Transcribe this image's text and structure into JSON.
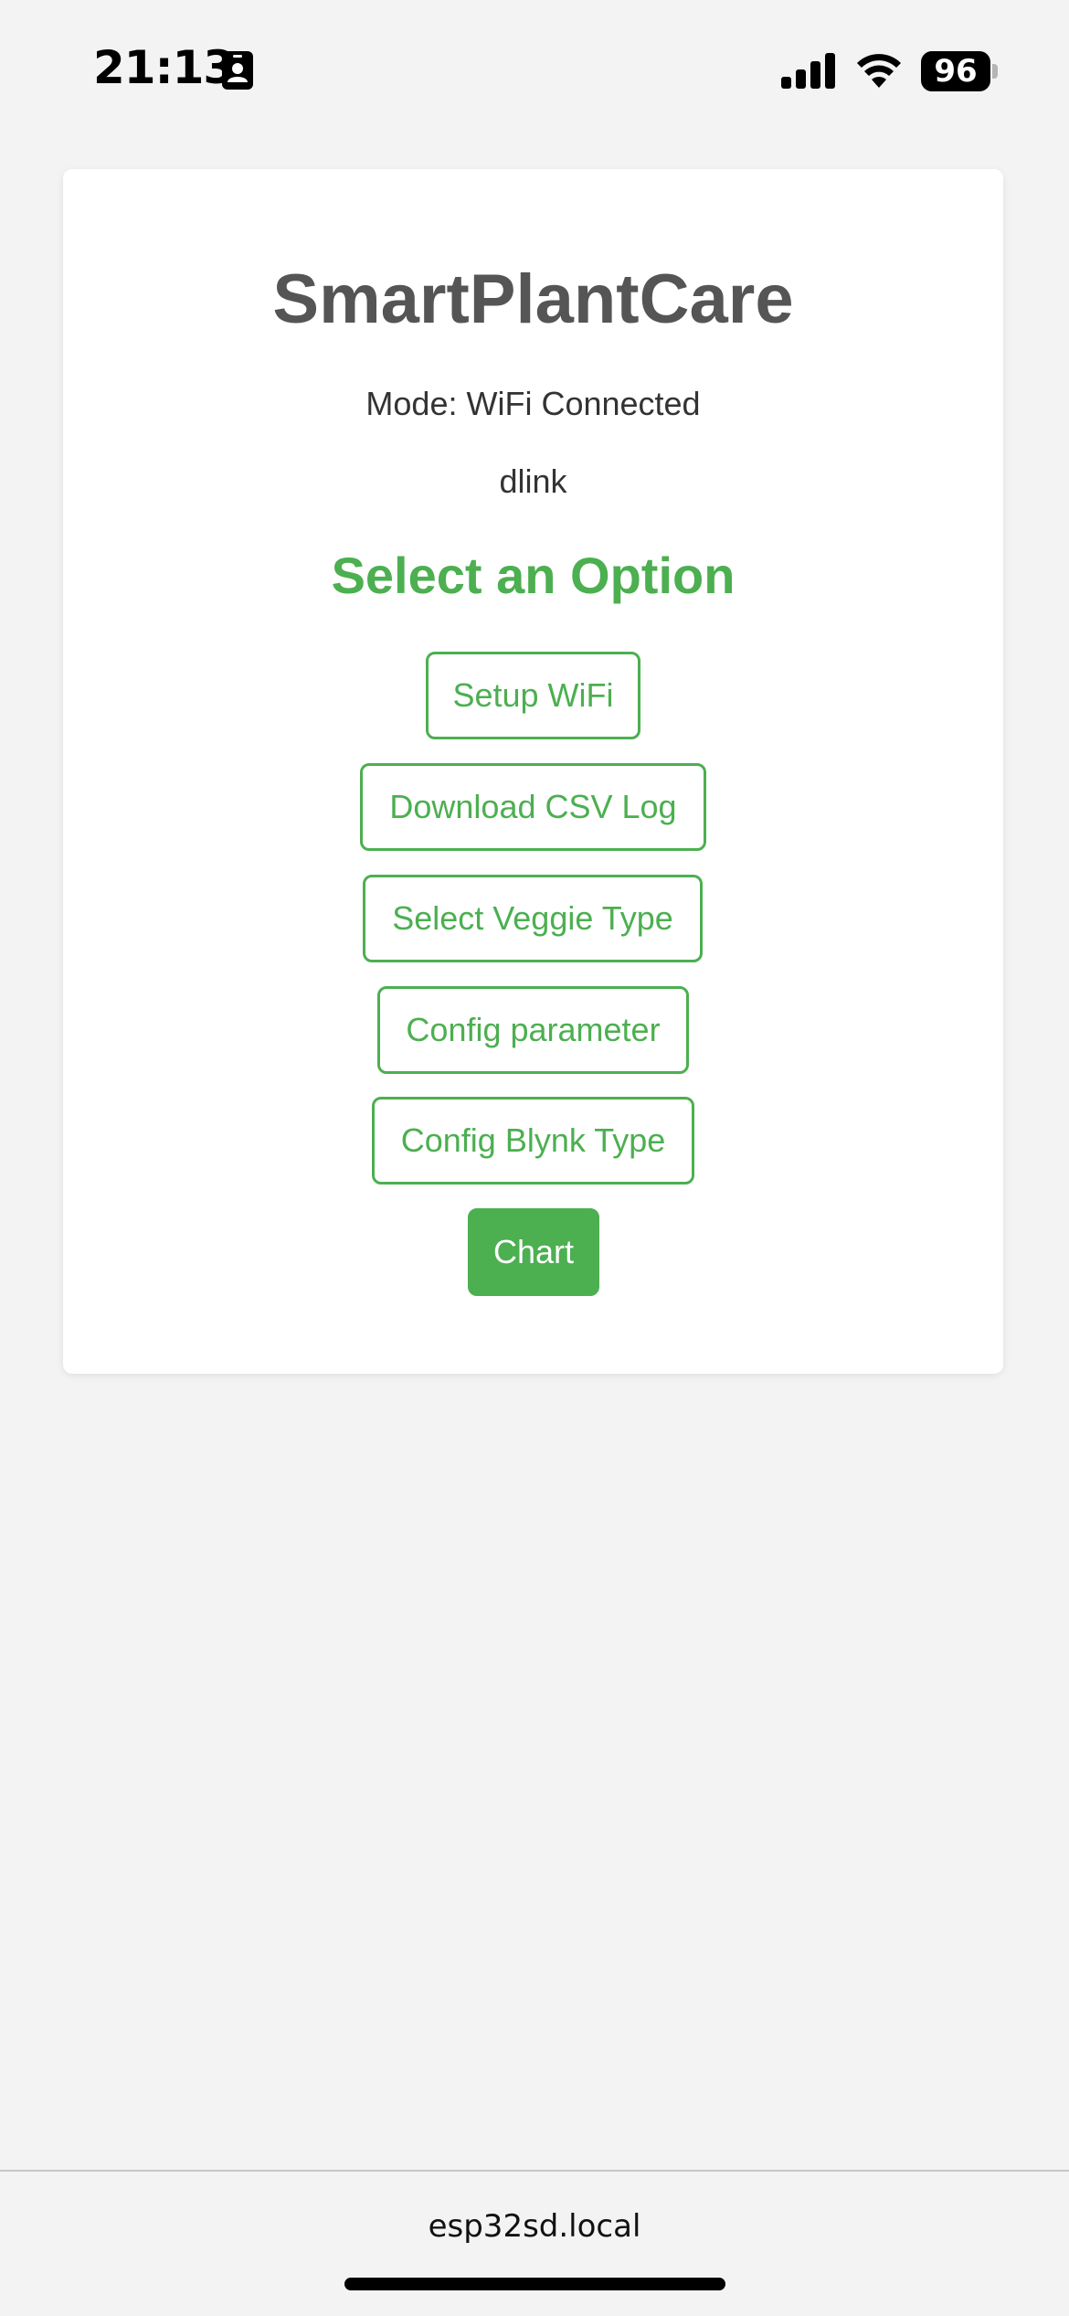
{
  "status_bar": {
    "time": "21:13",
    "battery_level": "96",
    "icons": [
      "contact-card-icon",
      "signal-icon",
      "wifi-icon",
      "battery-icon"
    ]
  },
  "card": {
    "title": "SmartPlantCare",
    "mode": "Mode: WiFi Connected",
    "ssid": "dlink",
    "heading": "Select an Option",
    "buttons": {
      "setup_wifi": "Setup WiFi",
      "download_csv": "Download CSV Log",
      "select_veggie": "Select Veggie Type",
      "config_parameter": "Config parameter",
      "config_blynk": "Config Blynk Type",
      "chart": "Chart"
    }
  },
  "browser": {
    "url": "esp32sd.local"
  },
  "colors": {
    "accent": "#4caf50",
    "title": "#555555",
    "background": "#f3f3f3",
    "card": "#ffffff"
  }
}
